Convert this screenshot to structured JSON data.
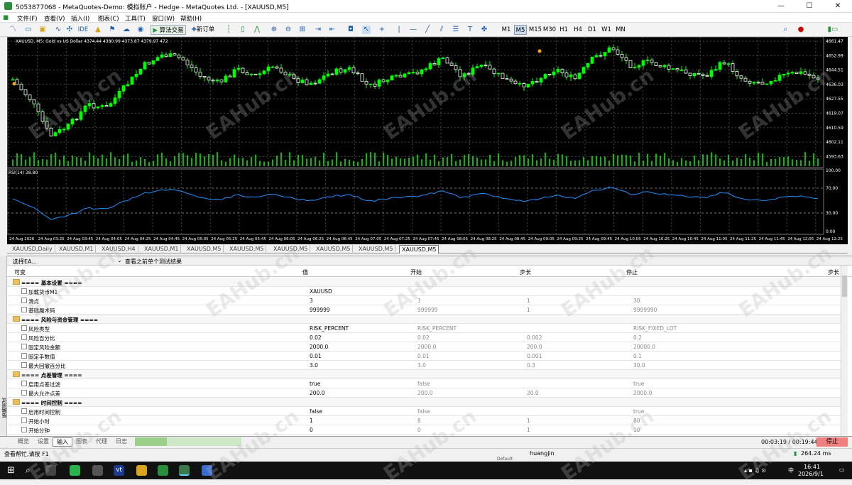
{
  "window": {
    "title": "5053877068 - MetaQuotes-Demo: 模拟账户 - Hedge - MetaQuotes Ltd. - [XAUUSD,M5]",
    "min": "—",
    "max": "☐",
    "close": "✕"
  },
  "menu": [
    "文件(F)",
    "查看(V)",
    "插入(I)",
    "图表(C)",
    "工具(T)",
    "窗口(W)",
    "帮助(H)"
  ],
  "toolbar": {
    "ide": "IDE",
    "algo": "算法交易",
    "neworder": "新订单",
    "timeframes": [
      "M1",
      "M5",
      "M15",
      "M30",
      "H1",
      "H4",
      "D1",
      "W1",
      "MN"
    ],
    "active_tf": "M5"
  },
  "chart": {
    "header": "XAUUSD, M5:  Gold vs US Dollar  4374.44 4380.99 4373.87 4379.97  472",
    "price_labels": [
      "4661.47",
      "4652.99",
      "4644.51",
      "4636.03",
      "4627.55",
      "4619.07",
      "4610.59",
      "4602.11",
      "4593.63"
    ],
    "rsi_label": "RSI(14) 28.80",
    "rsi_levels": [
      "100.00",
      "70.00",
      "30.00",
      "0.00"
    ],
    "time_labels": [
      "24 Aug 2026",
      "24 Aug 03:25",
      "24 Aug 03:45",
      "24 Aug 04:05",
      "24 Aug 04:25",
      "24 Aug 04:45",
      "24 Aug 05:05",
      "24 Aug 05:25",
      "24 Aug 05:45",
      "24 Aug 06:05",
      "24 Aug 06:25",
      "24 Aug 06:45",
      "24 Aug 07:05",
      "24 Aug 07:25",
      "24 Aug 07:45",
      "24 Aug 08:05",
      "24 Aug 08:25",
      "24 Aug 08:45",
      "24 Aug 09:05",
      "24 Aug 09:25",
      "24 Aug 09:45",
      "24 Aug 10:05",
      "24 Aug 10:25",
      "24 Aug 10:45",
      "24 Aug 11:05",
      "24 Aug 11:25",
      "24 Aug 11:45",
      "24 Aug 12:05",
      "24 Aug 12:25"
    ],
    "colors": {
      "bull": "#00ff00",
      "bear": "#ffffff",
      "grid": "#4a4a4a",
      "rsi": "#1e90ff",
      "bg": "#000000"
    }
  },
  "chart_tabs": [
    "XAUUSD,Daily",
    "XAUUSD,M1",
    "XAUUSD,H4",
    "XAUUSD,M1",
    "XAUUSD,M5",
    "XAUUSD,M5",
    "XAUUSD,M5",
    "XAUUSD,M5",
    "XAUUSD,M5",
    "XAUUSD,M5"
  ],
  "tester": {
    "select": "选择EA...",
    "prev_results": "查看之前单个测试结果",
    "headers": {
      "variable": "可变",
      "value": "值",
      "start": "开始",
      "step": "步长",
      "stop": "停止",
      "step2": "步长"
    },
    "rows": [
      {
        "type": "group",
        "name": "==== 基本设置 ===="
      },
      {
        "type": "item",
        "name": "加载货币M1",
        "value": "XAUUSD",
        "start": "",
        "step": "",
        "stop": ""
      },
      {
        "type": "item",
        "name": "滑点",
        "value": "3",
        "start": "3",
        "step": "1",
        "stop": "30"
      },
      {
        "type": "item",
        "name": "基础魔术码",
        "value": "999999",
        "start": "999999",
        "step": "1",
        "stop": "9999990"
      },
      {
        "type": "group",
        "name": "==== 风险与资金管理 ===="
      },
      {
        "type": "item",
        "name": "风险类型",
        "value": "RISK_PERCENT",
        "start": "RISK_PERCENT",
        "step": "",
        "stop": "RISK_FIXED_LOT"
      },
      {
        "type": "item",
        "name": "风险百分比",
        "value": "0.02",
        "start": "0.02",
        "step": "0.002",
        "stop": "0.2"
      },
      {
        "type": "item",
        "name": "固定风险金额",
        "value": "2000.0",
        "start": "2000.0",
        "step": "200.0",
        "stop": "20000.0"
      },
      {
        "type": "item",
        "name": "固定手数值",
        "value": "0.01",
        "start": "0.01",
        "step": "0.001",
        "stop": "0.1"
      },
      {
        "type": "item",
        "name": "最大回撤百分比",
        "value": "3.0",
        "start": "3.0",
        "step": "0.3",
        "stop": "30.0"
      },
      {
        "type": "group",
        "name": "==== 点差管理 ===="
      },
      {
        "type": "item",
        "name": "启用点差过滤",
        "value": "true",
        "start": "false",
        "step": "",
        "stop": "true"
      },
      {
        "type": "item",
        "name": "最大允许点差",
        "value": "200.0",
        "start": "200.0",
        "step": "20.0",
        "stop": "2000.0"
      },
      {
        "type": "group",
        "name": "==== 时间控制 ===="
      },
      {
        "type": "item",
        "name": "启用时间控制",
        "value": "false",
        "start": "false",
        "step": "",
        "stop": "true"
      },
      {
        "type": "item",
        "name": "开始小时",
        "value": "1",
        "start": "8",
        "step": "1",
        "stop": "80"
      },
      {
        "type": "item",
        "name": "开始分钟",
        "value": "0",
        "start": "0",
        "step": "1",
        "stop": "10"
      }
    ],
    "tabs": [
      "概览",
      "设置",
      "输入",
      "图表",
      "代理",
      "日志"
    ],
    "active_tab": "输入",
    "side_label": "策略测试",
    "timer": "00:03:19 / 00:19:44",
    "stop": "停止",
    "progress": 0.3
  },
  "status": {
    "help": "查看帮忙,请按 F1",
    "user": "huangjin",
    "default": "Default",
    "ping": "264.24 ms"
  },
  "taskbar": {
    "time": "16:41",
    "date": "2026/9/1",
    "lang": "中"
  },
  "watermark": "EAHub.cn"
}
